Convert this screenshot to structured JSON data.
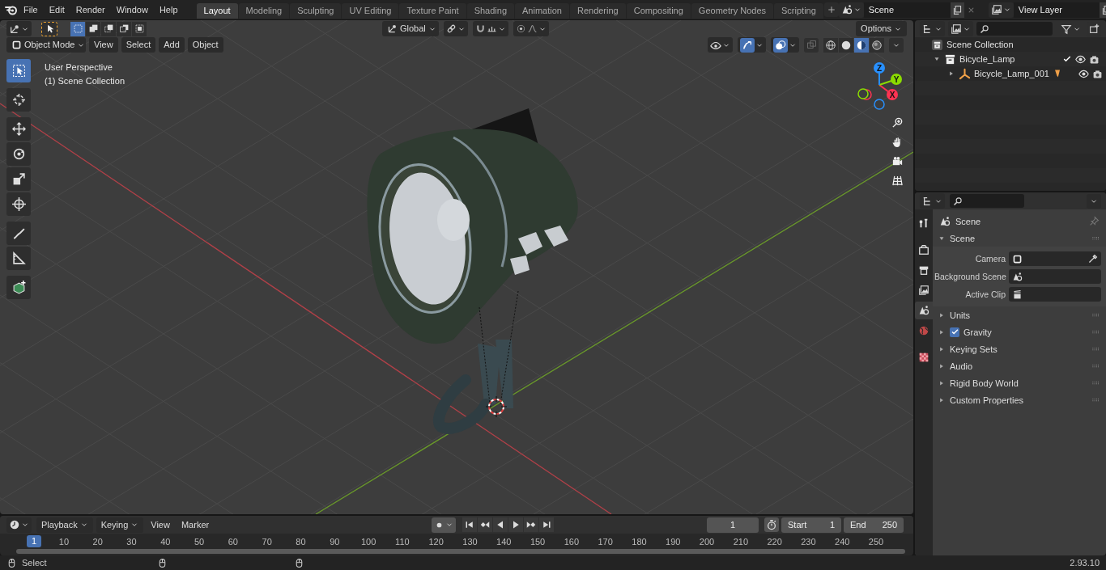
{
  "menu": [
    "File",
    "Edit",
    "Render",
    "Window",
    "Help"
  ],
  "workspaces": [
    {
      "label": "Layout",
      "selected": true
    },
    {
      "label": "Modeling",
      "selected": false
    },
    {
      "label": "Sculpting",
      "selected": false
    },
    {
      "label": "UV Editing",
      "selected": false
    },
    {
      "label": "Texture Paint",
      "selected": false
    },
    {
      "label": "Shading",
      "selected": false
    },
    {
      "label": "Animation",
      "selected": false
    },
    {
      "label": "Rendering",
      "selected": false
    },
    {
      "label": "Compositing",
      "selected": false
    },
    {
      "label": "Geometry Nodes",
      "selected": false
    },
    {
      "label": "Scripting",
      "selected": false
    }
  ],
  "scene_field": {
    "value": "Scene"
  },
  "view_layer_field": {
    "value": "View Layer"
  },
  "viewport": {
    "select_modes": [
      {
        "kind": "set",
        "selected": true
      },
      {
        "kind": "extend",
        "selected": false
      },
      {
        "kind": "subtract",
        "selected": false
      },
      {
        "kind": "invert",
        "selected": false
      },
      {
        "kind": "intersect",
        "selected": false
      }
    ],
    "orientation": "Global",
    "options": "Options",
    "mode": "Object Mode",
    "menus": [
      "View",
      "Select",
      "Add",
      "Object"
    ],
    "shading_modes": [
      {
        "kind": "wireframe",
        "selected": false
      },
      {
        "kind": "solid",
        "selected": false
      },
      {
        "kind": "material",
        "selected": true
      },
      {
        "kind": "rendered",
        "selected": false
      }
    ],
    "overlay_text": [
      "User Perspective",
      "(1) Scene Collection"
    ],
    "toolbar": [
      {
        "kind": "select",
        "selected": true
      },
      {
        "kind": "cursor",
        "selected": false
      },
      {
        "kind": "move",
        "selected": false
      },
      {
        "kind": "rotate",
        "selected": false
      },
      {
        "kind": "scale",
        "selected": false
      },
      {
        "kind": "transform",
        "selected": false
      },
      {
        "kind": "annotate",
        "selected": false
      },
      {
        "kind": "measure",
        "selected": false
      },
      {
        "kind": "add-cube",
        "selected": false
      }
    ],
    "gizmo_axes": [
      {
        "label": "X",
        "color": "#ff3352"
      },
      {
        "label": "Y",
        "color": "#8bdc00"
      },
      {
        "label": "Z",
        "color": "#2890ff"
      }
    ]
  },
  "outliner": {
    "tree": [
      {
        "label": "Scene Collection",
        "kind": "scene-collection",
        "children": [
          {
            "label": "Bicycle_Lamp",
            "kind": "collection",
            "expanded": true,
            "checked": true,
            "children": [
              {
                "label": "Bicycle_Lamp_001",
                "kind": "object",
                "expanded": false
              }
            ]
          }
        ]
      }
    ]
  },
  "properties": {
    "tabs": [
      {
        "kind": "tool",
        "selected": false
      },
      {
        "kind": "render",
        "selected": false
      },
      {
        "kind": "output",
        "selected": false
      },
      {
        "kind": "view-layer",
        "selected": false
      },
      {
        "kind": "scene",
        "selected": true
      },
      {
        "kind": "world",
        "selected": false
      },
      {
        "kind": "texture",
        "selected": false
      }
    ],
    "title": "Scene",
    "panels": [
      {
        "label": "Scene",
        "kind": "panel",
        "expanded": true,
        "fields": [
          {
            "label": "Camera",
            "kind": "camera"
          },
          {
            "label": "Background Scene",
            "kind": "scene"
          },
          {
            "label": "Active Clip",
            "kind": "clip"
          }
        ]
      },
      {
        "label": "Units",
        "kind": "panel",
        "expanded": false
      },
      {
        "label": "Gravity",
        "kind": "toggle",
        "expanded": false,
        "checked": true
      },
      {
        "label": "Keying Sets",
        "kind": "panel",
        "expanded": false
      },
      {
        "label": "Audio",
        "kind": "panel",
        "expanded": false
      },
      {
        "label": "Rigid Body World",
        "kind": "panel",
        "expanded": false
      },
      {
        "label": "Custom Properties",
        "kind": "panel",
        "expanded": false
      }
    ]
  },
  "timeline": {
    "menus": [
      {
        "label": "Playback",
        "kind": "dropdown"
      },
      {
        "label": "Keying",
        "kind": "dropdown"
      },
      {
        "label": "View",
        "kind": "menu"
      },
      {
        "label": "Marker",
        "kind": "menu"
      }
    ],
    "current_frame": "1",
    "start": {
      "label": "Start",
      "value": "1"
    },
    "end": {
      "label": "End",
      "value": "250"
    },
    "playhead": "1",
    "ruler": [
      "10",
      "20",
      "30",
      "40",
      "50",
      "60",
      "70",
      "80",
      "90",
      "100",
      "110",
      "120",
      "130",
      "140",
      "150",
      "160",
      "170",
      "180",
      "190",
      "200",
      "210",
      "220",
      "230",
      "240",
      "250"
    ]
  },
  "status_bar": {
    "hint": "Select",
    "version": "2.93.10"
  }
}
